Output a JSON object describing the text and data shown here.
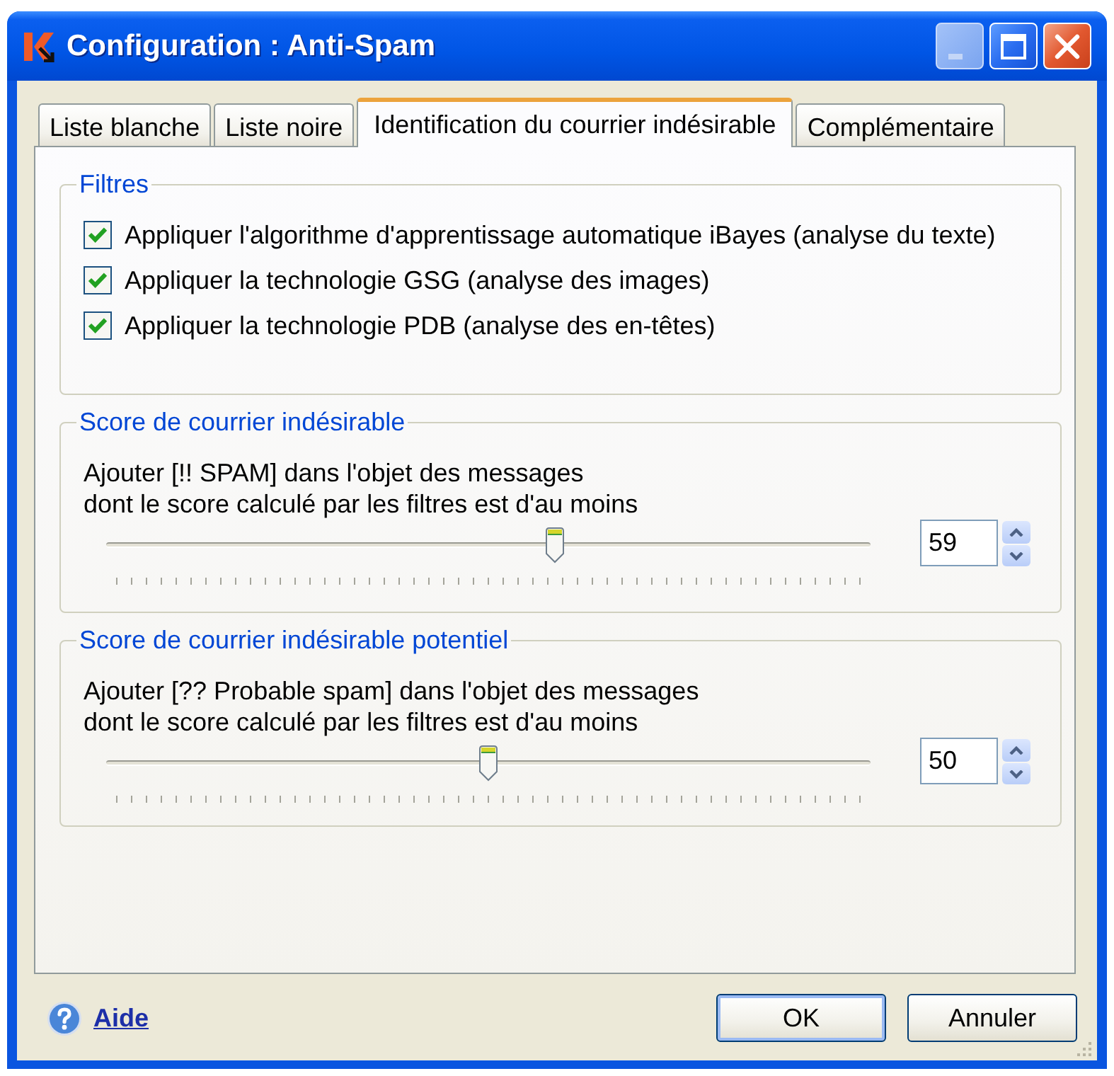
{
  "window": {
    "title": "Configuration : Anti-Spam",
    "controls": [
      {
        "kind": "minimize",
        "disabled": true
      },
      {
        "kind": "maximize",
        "disabled": false
      },
      {
        "kind": "close",
        "disabled": false
      }
    ]
  },
  "tabs": [
    {
      "label": "Liste blanche",
      "selected": false
    },
    {
      "label": "Liste noire",
      "selected": false
    },
    {
      "label": "Identification du courrier indésirable",
      "selected": true
    },
    {
      "label": "Complémentaire",
      "selected": false
    }
  ],
  "groups": [
    {
      "kind": "checklist",
      "legend": "Filtres",
      "items": [
        {
          "label": "Appliquer l'algorithme d'apprentissage automatique iBayes (analyse du texte)",
          "checked": true
        },
        {
          "label": "Appliquer la technologie GSG (analyse des images)",
          "checked": true
        },
        {
          "label": "Appliquer la technologie PDB (analyse des en-têtes)",
          "checked": true
        }
      ]
    },
    {
      "kind": "threshold",
      "legend": "Score de courrier indésirable",
      "description": "Ajouter [!! SPAM] dans l'objet des messages\ndont le score calculé par les filtres est d'au moins",
      "level": 0.59,
      "value": "59"
    },
    {
      "kind": "threshold",
      "legend": "Score de courrier indésirable potentiel",
      "description": "Ajouter [?? Probable spam] dans l'objet des messages\ndont le score calculé par les filtres est d'au moins",
      "level": 0.5,
      "value": "50"
    }
  ],
  "help_link": {
    "label": "Aide"
  },
  "buttons": [
    {
      "label": "OK",
      "default": true
    },
    {
      "label": "Annuler",
      "default": false
    }
  ]
}
